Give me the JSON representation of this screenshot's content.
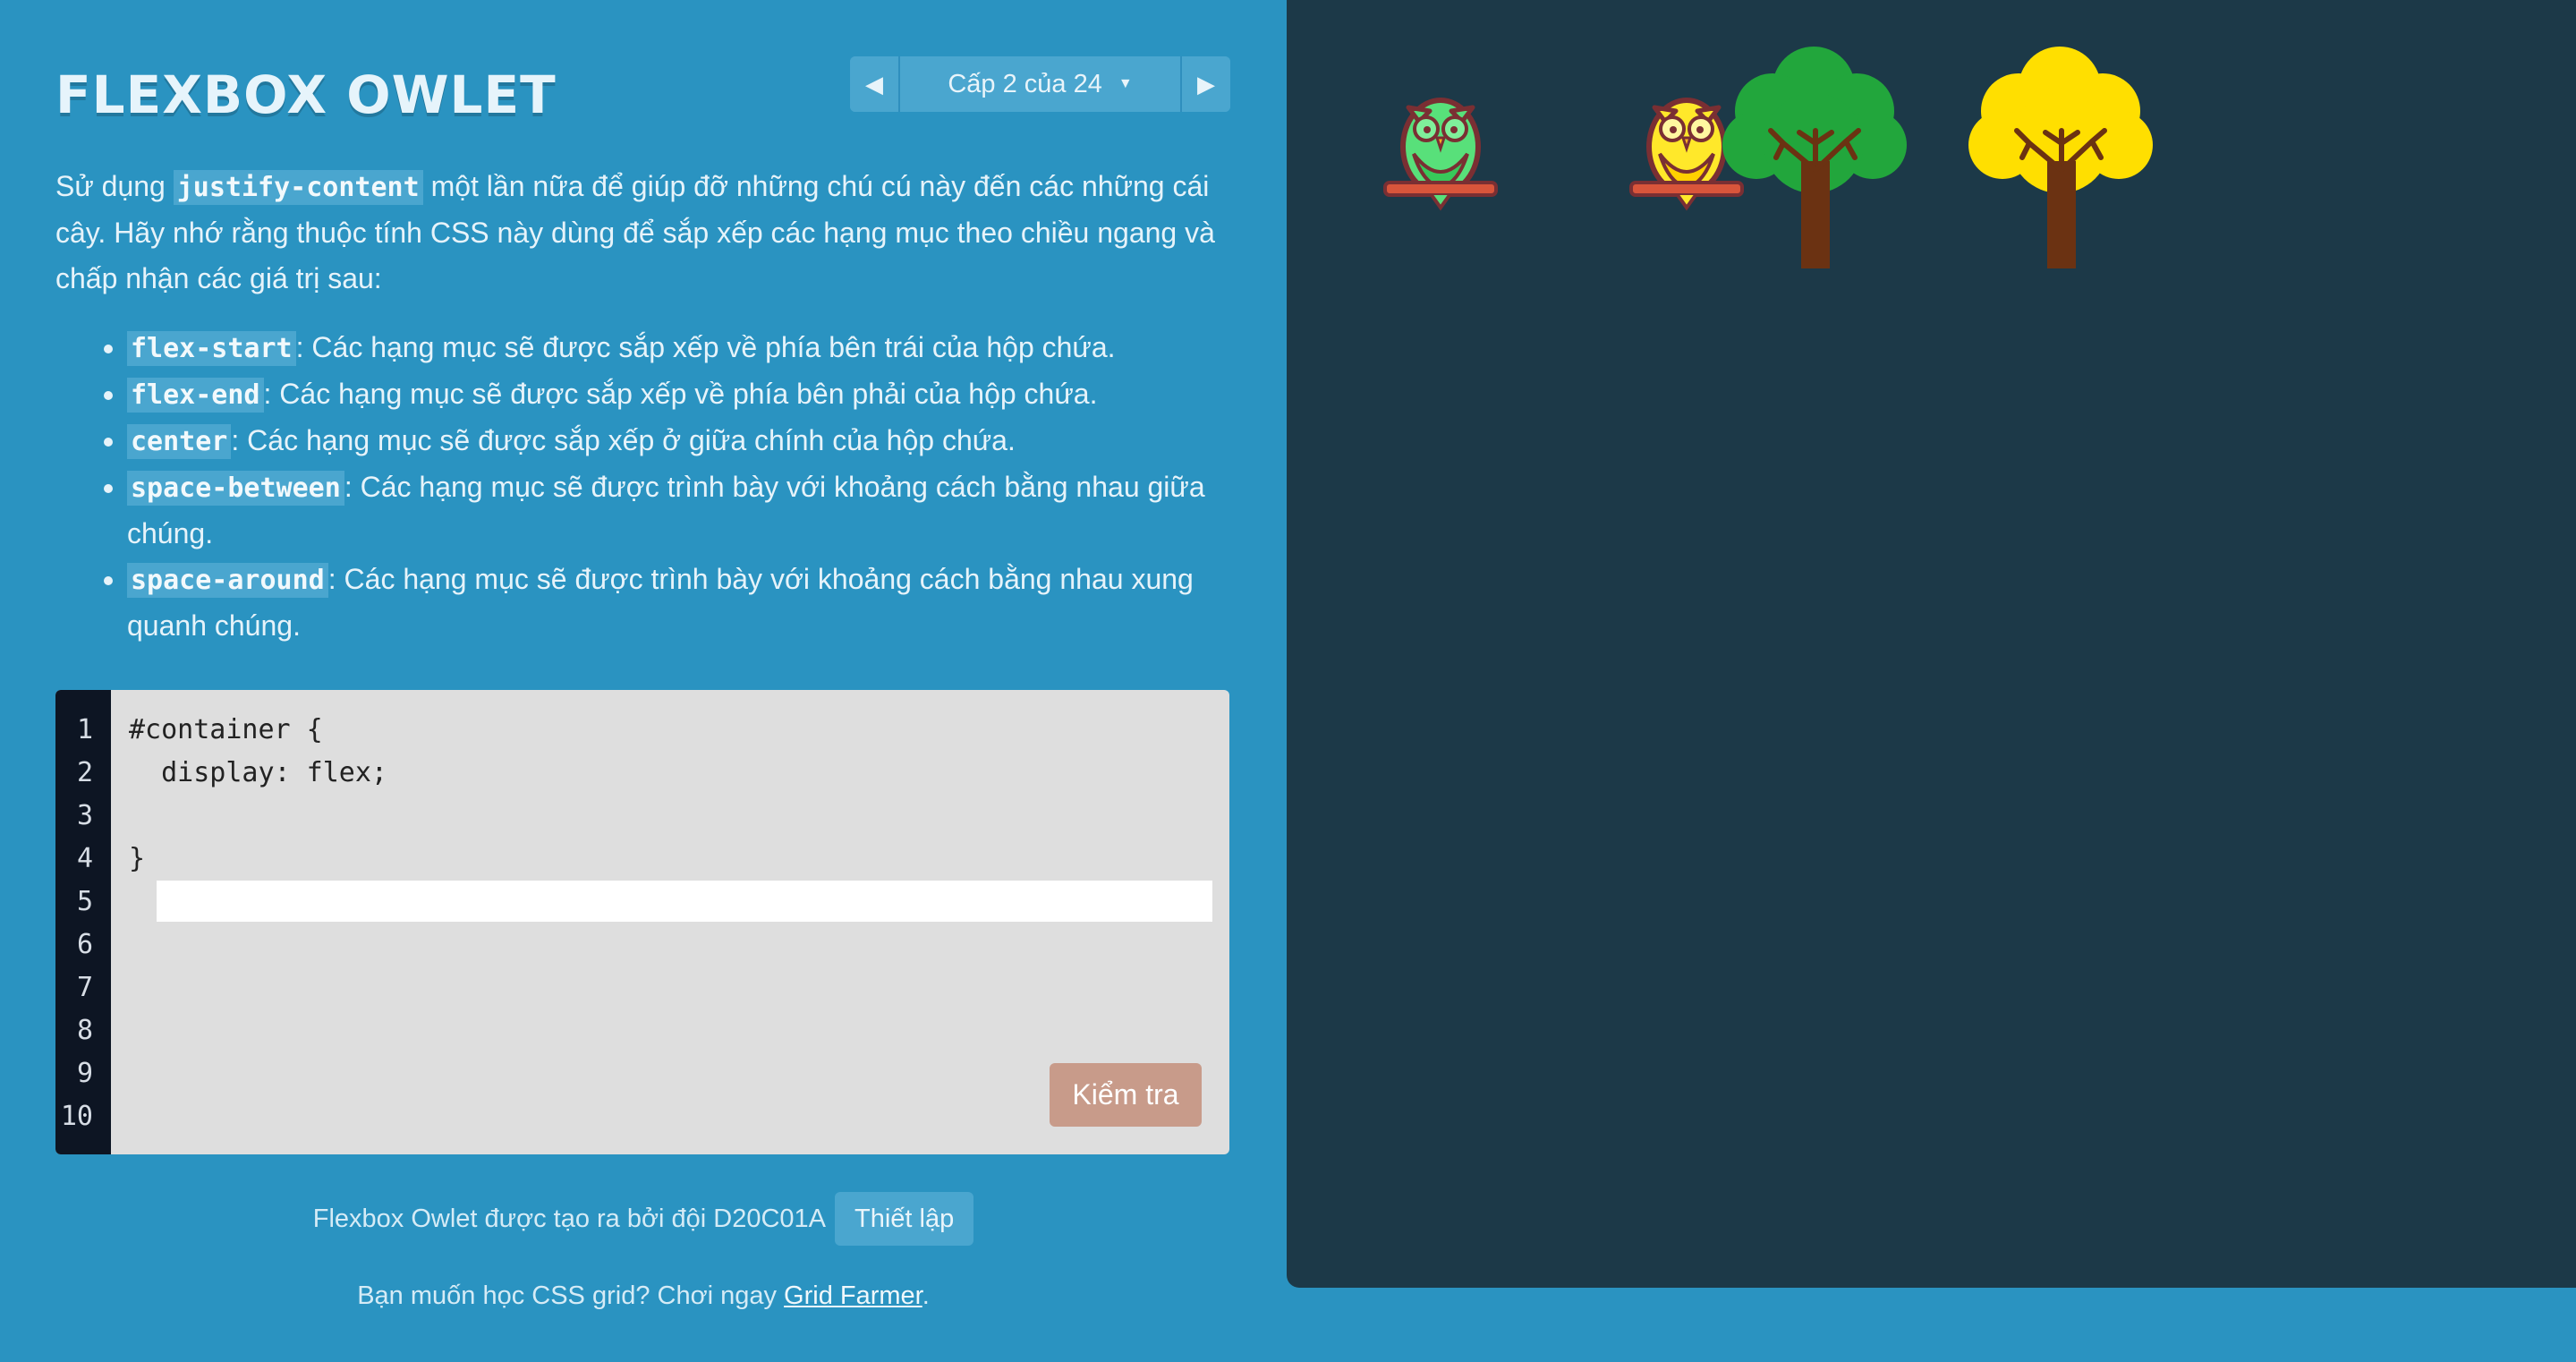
{
  "header": {
    "title": "FLEXBOX OWLET",
    "level_indicator": "Cấp 2 của 24",
    "prev_icon": "triangle-left-icon",
    "next_icon": "triangle-right-icon",
    "dropdown_icon": "caret-down-icon"
  },
  "instructions": {
    "intro_before": "Sử dụng ",
    "intro_code": "justify-content",
    "intro_after": " một lần nữa để giúp đỡ những chú cú này đến các những cái cây. Hãy nhớ rằng thuộc tính CSS này dùng để sắp xếp các hạng mục theo chiều ngang và chấp nhận các giá trị sau:",
    "values": [
      {
        "code": "flex-start",
        "desc": ": Các hạng mục sẽ được sắp xếp về phía bên trái của hộp chứa."
      },
      {
        "code": "flex-end",
        "desc": ": Các hạng mục sẽ được sắp xếp về phía bên phải của hộp chứa."
      },
      {
        "code": "center",
        "desc": ": Các hạng mục sẽ được sắp xếp ở giữa chính của hộp chứa."
      },
      {
        "code": "space-between",
        "desc": ": Các hạng mục sẽ được trình bày với khoảng cách bằng nhau giữa chúng."
      },
      {
        "code": "space-around",
        "desc": ": Các hạng mục sẽ được trình bày với khoảng cách bằng nhau xung quanh chúng."
      }
    ]
  },
  "editor": {
    "line_numbers": [
      "1",
      "2",
      "3",
      "4",
      "5",
      "6",
      "7",
      "8",
      "9",
      "10"
    ],
    "line1": "#container {",
    "line2": "  display: flex;",
    "answer_value": "",
    "line4": "}",
    "check_label": "Kiểm tra"
  },
  "footer": {
    "credits": "Flexbox Owlet được tạo ra bởi đội D20C01A",
    "settings_label": "Thiết lập",
    "promo_before": "Bạn muốn học CSS grid? Chơi ngay ",
    "promo_link": "Grid Farmer",
    "promo_after": "."
  },
  "board": {
    "background": "#1c3948",
    "owls": [
      {
        "color": "green",
        "hex": "#58e07a"
      },
      {
        "color": "yellow",
        "hex": "#ffe82a"
      }
    ],
    "trees": [
      {
        "color": "green",
        "hex": "#22a63c"
      },
      {
        "color": "yellow",
        "hex": "#ffdf00"
      }
    ]
  }
}
